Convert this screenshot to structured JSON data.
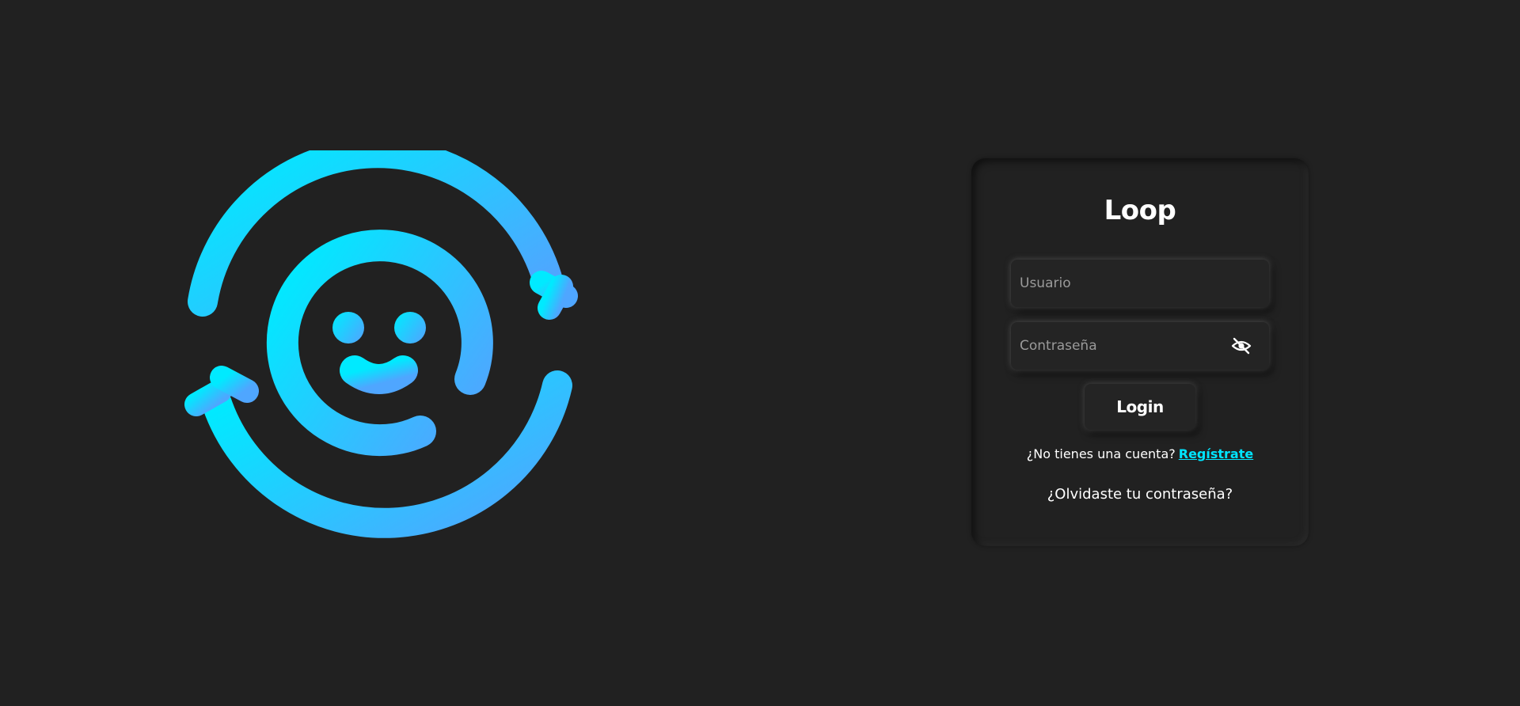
{
  "brand": {
    "logo_icon": "loop-smiley-icon",
    "gradient_start": "#00eaff",
    "gradient_end": "#4fa6ff"
  },
  "login": {
    "title": "Loop",
    "username_placeholder": "Usuario",
    "username_value": "",
    "password_placeholder": "Contraseña",
    "password_value": "",
    "password_toggle_icon": "eye-off-icon",
    "login_label": "Login",
    "signup_prompt": "¿No tienes una cuenta?",
    "signup_link": "Regístrate",
    "forgot_link": "¿Olvidaste tu contraseña?"
  },
  "colors": {
    "background": "#212121",
    "accent": "#00e5ff",
    "text": "#ffffff",
    "placeholder": "#9a9a9a"
  }
}
